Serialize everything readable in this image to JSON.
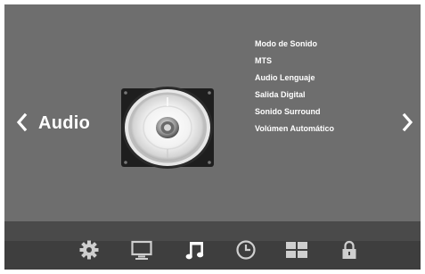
{
  "header": {
    "section_title": "Audio"
  },
  "menu": {
    "items": [
      {
        "label": "Modo de Sonido"
      },
      {
        "label": "MTS"
      },
      {
        "label": "Audio Lenguaje"
      },
      {
        "label": "Salida Digital"
      },
      {
        "label": "Sonido Surround"
      },
      {
        "label": "Volúmen Automático"
      }
    ]
  },
  "navigation": {
    "left_icon": "chevron-left-icon",
    "right_icon": "chevron-right-icon"
  },
  "toolbar": {
    "selected": "music-note-icon",
    "icons": [
      "gear-icon",
      "monitor-icon",
      "music-note-icon",
      "clock-icon",
      "grid-icon",
      "lock-icon"
    ]
  },
  "colors": {
    "background": "#6e6e6e",
    "toolbar": "#3e3e3e",
    "text": "#ffffff",
    "icon_inactive": "#cfcfcf",
    "icon_active": "#ffffff"
  }
}
